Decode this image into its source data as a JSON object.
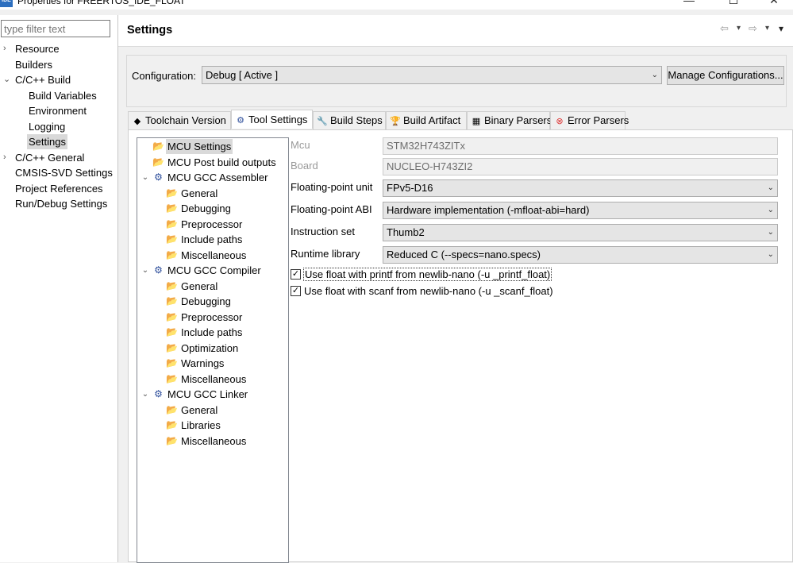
{
  "window": {
    "app_icon": "IDE",
    "title": "Properties for FREERTOS_IDE_FLOAT",
    "minimize": "—",
    "maximize": "☐",
    "close": "✕"
  },
  "filter": {
    "placeholder": "type filter text"
  },
  "nav": [
    {
      "label": "Resource",
      "twisty": "›"
    },
    {
      "label": "Builders",
      "twisty": ""
    },
    {
      "label": "C/C++ Build",
      "twisty": "⌄"
    },
    {
      "label": "Build Variables",
      "twisty": ""
    },
    {
      "label": "Environment",
      "twisty": ""
    },
    {
      "label": "Logging",
      "twisty": ""
    },
    {
      "label": "Settings",
      "twisty": ""
    },
    {
      "label": "C/C++ General",
      "twisty": "›"
    },
    {
      "label": "CMSIS-SVD Settings",
      "twisty": ""
    },
    {
      "label": "Project References",
      "twisty": ""
    },
    {
      "label": "Run/Debug Settings",
      "twisty": ""
    }
  ],
  "header": {
    "title": "Settings",
    "back": "⇦",
    "forward": "⇨",
    "dropdown": "▾",
    "menu": "▾"
  },
  "configuration": {
    "label": "Configuration:",
    "value": "Debug  [ Active ]",
    "caret": "⌄",
    "manage_label": "Manage Configurations..."
  },
  "tabs": [
    {
      "label": "Toolchain  Version",
      "icon": "◆"
    },
    {
      "label": "Tool Settings",
      "icon": "⚙"
    },
    {
      "label": "Build Steps",
      "icon": "🔧"
    },
    {
      "label": "Build Artifact",
      "icon": "🏆"
    },
    {
      "label": "Binary Parsers",
      "icon": "▦"
    },
    {
      "label": "Error Parsers",
      "icon": "⊗"
    }
  ],
  "tree": [
    {
      "label": "MCU Settings",
      "icon": "📂"
    },
    {
      "label": "MCU Post build outputs",
      "icon": "📂"
    },
    {
      "label": "MCU GCC Assembler",
      "icon": "⚙",
      "twisty": "⌄"
    },
    {
      "label": "General",
      "icon": "📂"
    },
    {
      "label": "Debugging",
      "icon": "📂"
    },
    {
      "label": "Preprocessor",
      "icon": "📂"
    },
    {
      "label": "Include paths",
      "icon": "📂"
    },
    {
      "label": "Miscellaneous",
      "icon": "📂"
    },
    {
      "label": "MCU GCC Compiler",
      "icon": "⚙",
      "twisty": "⌄"
    },
    {
      "label": "General",
      "icon": "📂"
    },
    {
      "label": "Debugging",
      "icon": "📂"
    },
    {
      "label": "Preprocessor",
      "icon": "📂"
    },
    {
      "label": "Include paths",
      "icon": "📂"
    },
    {
      "label": "Optimization",
      "icon": "📂"
    },
    {
      "label": "Warnings",
      "icon": "📂"
    },
    {
      "label": "Miscellaneous",
      "icon": "📂"
    },
    {
      "label": "MCU GCC Linker",
      "icon": "⚙",
      "twisty": "⌄"
    },
    {
      "label": "General",
      "icon": "📂"
    },
    {
      "label": "Libraries",
      "icon": "📂"
    },
    {
      "label": "Miscellaneous",
      "icon": "📂"
    }
  ],
  "props": {
    "mcu": {
      "label": "Mcu",
      "value": "STM32H743ZITx"
    },
    "board": {
      "label": "Board",
      "value": "NUCLEO-H743ZI2"
    },
    "fpu": {
      "label": "Floating-point unit",
      "value": "FPv5-D16"
    },
    "fabi": {
      "label": "Floating-point ABI",
      "value": "Hardware implementation (-mfloat-abi=hard)"
    },
    "iset": {
      "label": "Instruction set",
      "value": "Thumb2"
    },
    "rtlib": {
      "label": "Runtime library",
      "value": "Reduced C (--specs=nano.specs)"
    },
    "caret": "⌄",
    "printf": {
      "label": "Use float with printf from newlib-nano (-u _printf_float)",
      "checked": "✓"
    },
    "scanf": {
      "label": "Use float with scanf from newlib-nano (-u _scanf_float)",
      "checked": "✓"
    }
  }
}
